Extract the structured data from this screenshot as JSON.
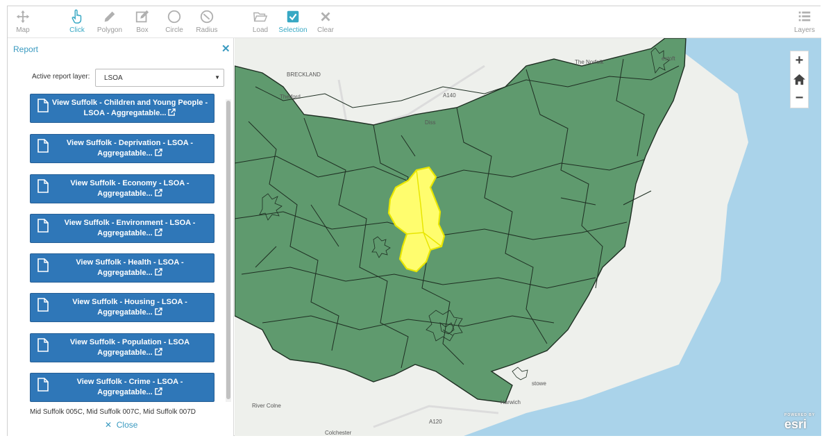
{
  "toolbar": {
    "map": "Map",
    "click": "Click",
    "polygon": "Polygon",
    "box": "Box",
    "circle": "Circle",
    "radius": "Radius",
    "load": "Load",
    "selection": "Selection",
    "clear": "Clear",
    "layers": "Layers"
  },
  "panel": {
    "title": "Report",
    "active_layer_label": "Active report layer:",
    "active_layer_value": "LSOA",
    "buttons": [
      {
        "label": "View Suffolk - Children and Young People - LSOA - Aggregatable..."
      },
      {
        "label": "View Suffolk - Deprivation - LSOA - Aggregatable..."
      },
      {
        "label": "View Suffolk - Economy - LSOA - Aggregatable..."
      },
      {
        "label": "View Suffolk - Environment - LSOA - Aggregatable..."
      },
      {
        "label": "View Suffolk - Health - LSOA - Aggregatable..."
      },
      {
        "label": "View Suffolk - Housing - LSOA - Aggregatable..."
      },
      {
        "label": "View Suffolk - Population - LSOA Aggregatable..."
      },
      {
        "label": "View Suffolk - Crime - LSOA - Aggregatable..."
      }
    ],
    "selection_text": "Mid Suffolk 005C, Mid Suffolk 007C, Mid Suffolk 007D",
    "close_label": "Close"
  },
  "map": {
    "labels": {
      "breckland": "BRECKLAND",
      "thetford": "Thetford",
      "diss": "Diss",
      "norfolk": "The Norfolk",
      "lowestoft": "estoft",
      "felixstowe": "stowe",
      "harwich": "Harwich",
      "colchester": "Colchester",
      "a140": "A140",
      "a120": "A120",
      "river_colne": "River Colne"
    },
    "zoom_in": "+",
    "zoom_out": "−",
    "powered_by": "POWERED BY",
    "esri": "esri"
  },
  "colors": {
    "accent": "#37a8c4",
    "button": "#2f77b8",
    "region": "#5f9a6e",
    "selection": "#fffd6e",
    "sea": "#aad3ea"
  }
}
